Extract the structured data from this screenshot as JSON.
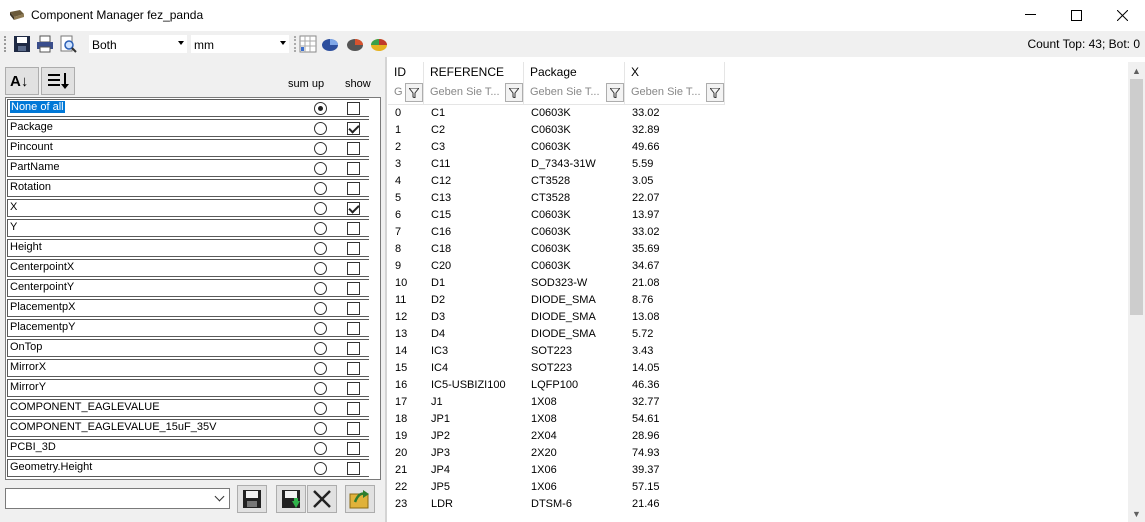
{
  "window": {
    "title": "Component Manager fez_panda",
    "minimize": "—",
    "maximize": "☐",
    "close": "✕"
  },
  "toolbar": {
    "side_value": "Both",
    "unit_value": "mm",
    "count_text": "Count Top: 43; Bot: 0"
  },
  "left_panel": {
    "sort_az_label": "A↓",
    "sort_list_label": "≡↓",
    "sum_up_label": "sum up",
    "show_label": "show",
    "items": [
      {
        "label": "None of all",
        "sumup": true,
        "show": false,
        "selected": true
      },
      {
        "label": "Package",
        "sumup": false,
        "show": true
      },
      {
        "label": "Pincount",
        "sumup": false,
        "show": false
      },
      {
        "label": "PartName",
        "sumup": false,
        "show": false
      },
      {
        "label": "Rotation",
        "sumup": false,
        "show": false
      },
      {
        "label": "X",
        "sumup": false,
        "show": true
      },
      {
        "label": "Y",
        "sumup": false,
        "show": false
      },
      {
        "label": "Height",
        "sumup": false,
        "show": false
      },
      {
        "label": "CenterpointX",
        "sumup": false,
        "show": false
      },
      {
        "label": "CenterpointY",
        "sumup": false,
        "show": false
      },
      {
        "label": "PlacementpX",
        "sumup": false,
        "show": false
      },
      {
        "label": "PlacementpY",
        "sumup": false,
        "show": false
      },
      {
        "label": "OnTop",
        "sumup": false,
        "show": false
      },
      {
        "label": "MirrorX",
        "sumup": false,
        "show": false
      },
      {
        "label": "MirrorY",
        "sumup": false,
        "show": false
      },
      {
        "label": "COMPONENT_EAGLEVALUE",
        "sumup": false,
        "show": false
      },
      {
        "label": "COMPONENT_EAGLEVALUE_15uF_35V",
        "sumup": false,
        "show": false
      },
      {
        "label": "PCBI_3D",
        "sumup": false,
        "show": false
      },
      {
        "label": "Geometry.Height",
        "sumup": false,
        "show": false
      }
    ],
    "preset_value": ""
  },
  "grid": {
    "columns": [
      "ID",
      "REFERENCE",
      "Package",
      "X"
    ],
    "filters": [
      "G",
      "Geben Sie T...",
      "Geben Sie T...",
      "Geben Sie T..."
    ],
    "rows": [
      [
        "0",
        "C1",
        "C0603K",
        "33.02"
      ],
      [
        "1",
        "C2",
        "C0603K",
        "32.89"
      ],
      [
        "2",
        "C3",
        "C0603K",
        "49.66"
      ],
      [
        "3",
        "C11",
        "D_7343-31W",
        "5.59"
      ],
      [
        "4",
        "C12",
        "CT3528",
        "3.05"
      ],
      [
        "5",
        "C13",
        "CT3528",
        "22.07"
      ],
      [
        "6",
        "C15",
        "C0603K",
        "13.97"
      ],
      [
        "7",
        "C16",
        "C0603K",
        "33.02"
      ],
      [
        "8",
        "C18",
        "C0603K",
        "35.69"
      ],
      [
        "9",
        "C20",
        "C0603K",
        "34.67"
      ],
      [
        "10",
        "D1",
        "SOD323-W",
        "21.08"
      ],
      [
        "11",
        "D2",
        "DIODE_SMA",
        "8.76"
      ],
      [
        "12",
        "D3",
        "DIODE_SMA",
        "13.08"
      ],
      [
        "13",
        "D4",
        "DIODE_SMA",
        "5.72"
      ],
      [
        "14",
        "IC3",
        "SOT223",
        "3.43"
      ],
      [
        "15",
        "IC4",
        "SOT223",
        "14.05"
      ],
      [
        "16",
        "IC5-USBIZI100",
        "LQFP100",
        "46.36"
      ],
      [
        "17",
        "J1",
        "1X08",
        "32.77"
      ],
      [
        "18",
        "JP1",
        "1X08",
        "54.61"
      ],
      [
        "19",
        "JP2",
        "2X04",
        "28.96"
      ],
      [
        "20",
        "JP3",
        "2X20",
        "74.93"
      ],
      [
        "21",
        "JP4",
        "1X06",
        "39.37"
      ],
      [
        "22",
        "JP5",
        "1X06",
        "57.15"
      ],
      [
        "23",
        "LDR",
        "DTSM-6",
        "21.46"
      ]
    ]
  }
}
